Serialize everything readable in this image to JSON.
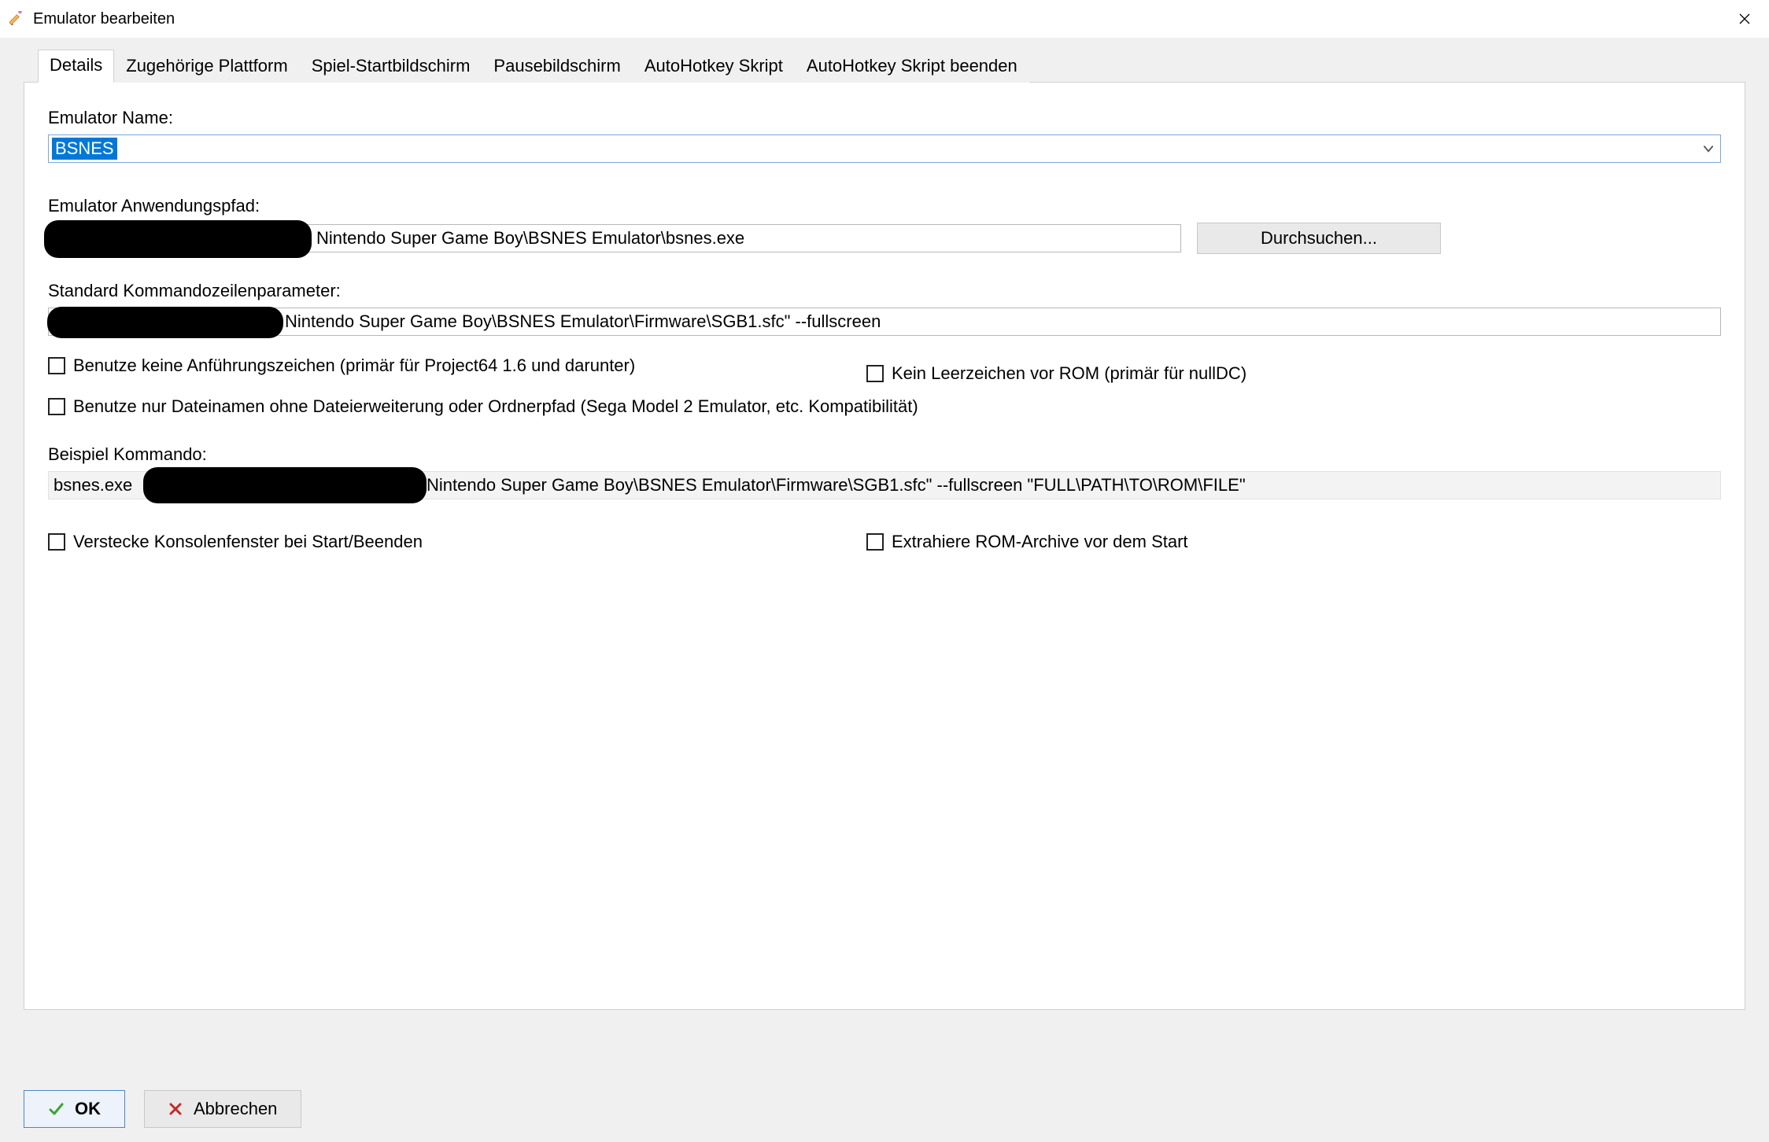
{
  "window": {
    "title": "Emulator bearbeiten"
  },
  "tabs": {
    "t0": "Details",
    "t1": "Zugehörige Plattform",
    "t2": "Spiel-Startbildschirm",
    "t3": "Pausebildschirm",
    "t4": "AutoHotkey Skript",
    "t5": "AutoHotkey Skript beenden"
  },
  "labels": {
    "emulator_name": "Emulator Name:",
    "app_path": "Emulator Anwendungspfad:",
    "cmd_params": "Standard Kommandozeilenparameter:",
    "example_cmd": "Beispiel Kommando:"
  },
  "values": {
    "emulator_name": "BSNES",
    "app_path_visible": "Nintendo Super Game Boy\\BSNES Emulator\\bsnes.exe",
    "cmd_params_visible": "Nintendo Super Game Boy\\BSNES Emulator\\Firmware\\SGB1.sfc\" --fullscreen",
    "example_prefix": "bsnes.exe",
    "example_suffix": "Nintendo Super Game Boy\\BSNES Emulator\\Firmware\\SGB1.sfc\" --fullscreen \"FULL\\PATH\\TO\\ROM\\FILE\""
  },
  "buttons": {
    "browse": "Durchsuchen...",
    "ok": "OK",
    "cancel": "Abbrechen"
  },
  "checks": {
    "no_quotes": "Benutze keine Anführungszeichen (primär für Project64 1.6 und darunter)",
    "no_space": "Kein Leerzeichen vor ROM (primär für nullDC)",
    "filename_only": "Benutze nur Dateinamen ohne Dateierweiterung oder Ordnerpfad (Sega Model 2 Emulator, etc. Kompatibilität)",
    "hide_console": "Verstecke Konsolenfenster bei Start/Beenden",
    "extract_rom": "Extrahiere ROM-Archive vor dem Start"
  }
}
